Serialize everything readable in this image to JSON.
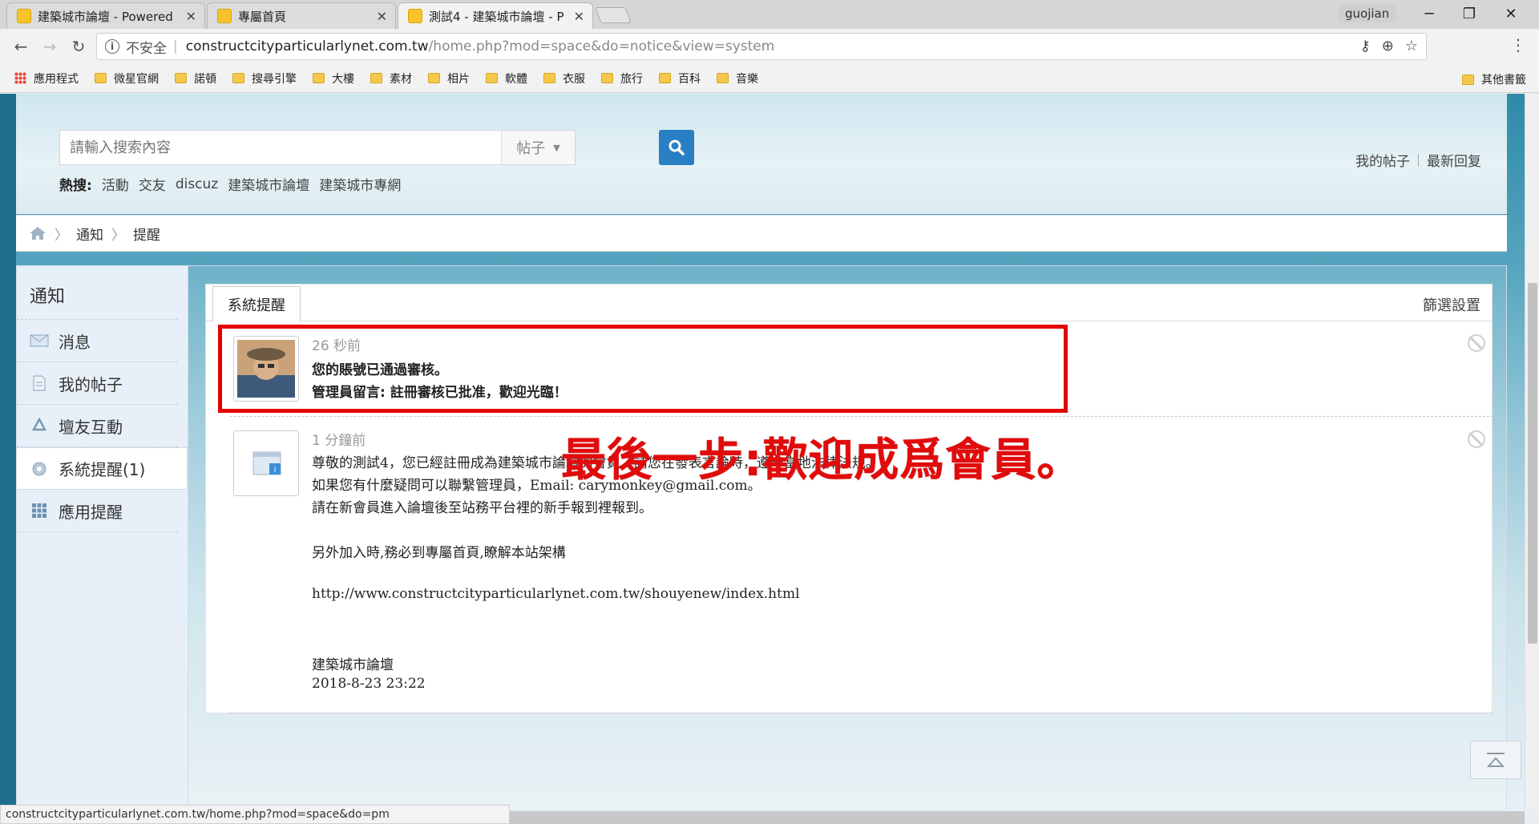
{
  "browser": {
    "tabs": [
      {
        "title": "建築城市論壇 - Powered",
        "active": false
      },
      {
        "title": "專屬首頁",
        "active": false
      },
      {
        "title": "測試4 - 建築城市論壇 - P",
        "active": true
      }
    ],
    "profile_name": "guojian",
    "address": {
      "security_label": "不安全",
      "host": "constructcityparticularlynet.com.tw",
      "path": "/home.php?mod=space&do=notice&view=system"
    },
    "bookmarks": [
      "應用程式",
      "微星官網",
      "諾頓",
      "搜尋引擎",
      "大樓",
      "素材",
      "相片",
      "軟體",
      "衣服",
      "旅行",
      "百科",
      "音樂"
    ],
    "other_bookmarks": "其他書籤",
    "status_url": "constructcityparticularlynet.com.tw/home.php?mod=space&do=pm"
  },
  "header": {
    "search_placeholder": "請輸入搜索內容",
    "search_type": "帖子",
    "hot_label": "熱搜:",
    "hot_items": [
      "活動",
      "交友",
      "discuz",
      "建築城市論壇",
      "建築城市專網"
    ],
    "my_posts": "我的帖子",
    "latest_replies": "最新回复"
  },
  "breadcrumb": [
    "通知",
    "提醒"
  ],
  "sidebar": {
    "title": "通知",
    "items": [
      {
        "label": "消息",
        "icon": "mail-icon"
      },
      {
        "label": "我的帖子",
        "icon": "document-icon"
      },
      {
        "label": "壇友互動",
        "icon": "recycle-icon"
      },
      {
        "label": "系統提醒(1)",
        "icon": "gear-icon",
        "active": true
      },
      {
        "label": "應用提醒",
        "icon": "apps-grid-icon"
      }
    ]
  },
  "main": {
    "tab_label": "系統提醒",
    "filter_label": "篩選設置",
    "overlay_caption": "最後一步:歡迎成爲會員。",
    "notices": [
      {
        "time": "26 秒前",
        "lines": [
          "您的賬號已通過審核。",
          "管理員留言: 註冊審核已批准，歡迎光臨！"
        ]
      },
      {
        "time": "1 分鐘前",
        "lines": [
          "尊敬的測試4，您已經註冊成為建築城市論壇的會員，請您在發表言論時，遵守當地法律法規。",
          "如果您有什麼疑問可以聯繫管理員，Email: carymonkey@gmail.com。",
          "請在新會員進入論壇後至站務平台裡的新手報到裡報到。",
          "另外加入時,務必到專屬首頁,瞭解本站架構",
          "http://www.constructcityparticularlynet.com.tw/shouyenew/index.html",
          "建築城市論壇",
          "2018-8-23 23:22"
        ]
      }
    ]
  },
  "colors": {
    "accent_blue": "#2a7fc4",
    "highlight_red": "#e30000"
  }
}
